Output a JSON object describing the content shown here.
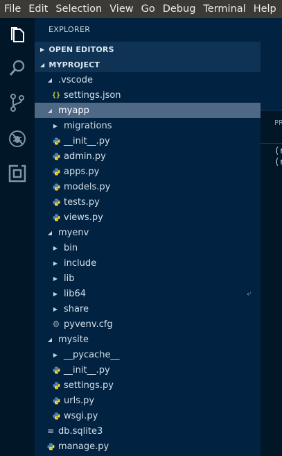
{
  "menubar": {
    "items": [
      "File",
      "Edit",
      "Selection",
      "View",
      "Go",
      "Debug",
      "Terminal",
      "Help"
    ]
  },
  "activitybar": {
    "items": [
      "files-icon",
      "search-icon",
      "source-control-icon",
      "debug-icon",
      "extensions-icon"
    ]
  },
  "sidebar": {
    "title": "EXPLORER",
    "sections": {
      "open_editors": "OPEN EDITORS",
      "project": "MYPROJECT"
    },
    "tree": [
      {
        "label": ".vscode",
        "type": "folder",
        "expanded": true,
        "indent": 1
      },
      {
        "label": "settings.json",
        "type": "json",
        "indent": 2
      },
      {
        "label": "myapp",
        "type": "folder",
        "expanded": true,
        "indent": 1,
        "selected": true
      },
      {
        "label": "migrations",
        "type": "folder",
        "expanded": false,
        "indent": 2
      },
      {
        "label": "__init__.py",
        "type": "python",
        "indent": 2
      },
      {
        "label": "admin.py",
        "type": "python",
        "indent": 2
      },
      {
        "label": "apps.py",
        "type": "python",
        "indent": 2
      },
      {
        "label": "models.py",
        "type": "python",
        "indent": 2
      },
      {
        "label": "tests.py",
        "type": "python",
        "indent": 2
      },
      {
        "label": "views.py",
        "type": "python",
        "indent": 2
      },
      {
        "label": "myenv",
        "type": "folder",
        "expanded": true,
        "indent": 1
      },
      {
        "label": "bin",
        "type": "folder",
        "expanded": false,
        "indent": 2
      },
      {
        "label": "include",
        "type": "folder",
        "expanded": false,
        "indent": 2
      },
      {
        "label": "lib",
        "type": "folder",
        "expanded": false,
        "indent": 2
      },
      {
        "label": "lib64",
        "type": "folder",
        "expanded": false,
        "indent": 2,
        "symlink": true
      },
      {
        "label": "share",
        "type": "folder",
        "expanded": false,
        "indent": 2
      },
      {
        "label": "pyvenv.cfg",
        "type": "config",
        "indent": 2
      },
      {
        "label": "mysite",
        "type": "folder",
        "expanded": true,
        "indent": 1
      },
      {
        "label": "__pycache__",
        "type": "folder",
        "expanded": false,
        "indent": 2
      },
      {
        "label": "__init__.py",
        "type": "python",
        "indent": 2
      },
      {
        "label": "settings.py",
        "type": "python",
        "indent": 2
      },
      {
        "label": "urls.py",
        "type": "python",
        "indent": 2
      },
      {
        "label": "wsgi.py",
        "type": "python",
        "indent": 2
      },
      {
        "label": "db.sqlite3",
        "type": "text",
        "indent": 1
      },
      {
        "label": "manage.py",
        "type": "python",
        "indent": 1
      }
    ]
  },
  "editor": {
    "panel_title": "PR",
    "terminal_lines": [
      "(r",
      "(r"
    ]
  },
  "colors": {
    "menubar_bg": "#3b3a36",
    "activitybar_bg": "#011627",
    "sidebar_bg": "#012341",
    "selection_bg": "#4e6886",
    "python_blue": "#4b8bbe",
    "python_yellow": "#ffd43b",
    "json_yellow": "#cbcb41"
  }
}
